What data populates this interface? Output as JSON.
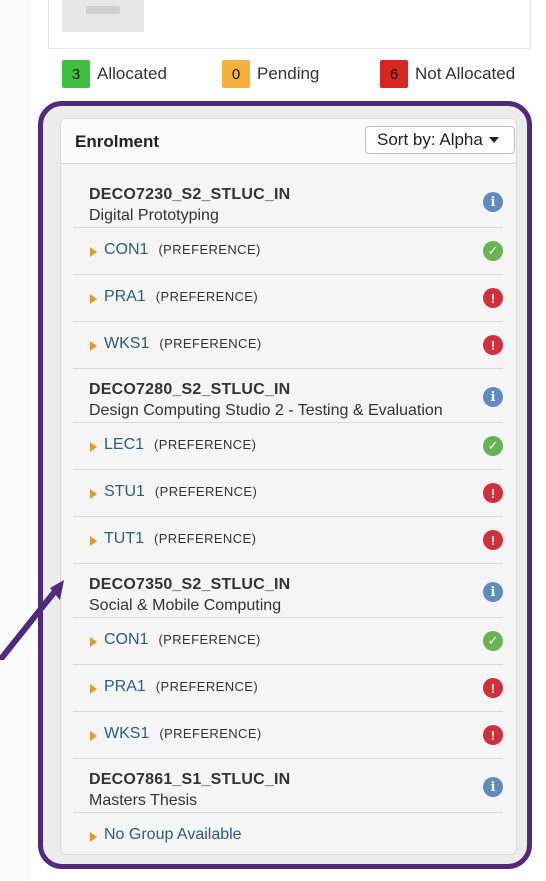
{
  "legend": [
    {
      "count": "3",
      "label": "Allocated",
      "color": "#3fbf3f"
    },
    {
      "count": "0",
      "label": "Pending",
      "color": "#f5b13a"
    },
    {
      "count": "6",
      "label": "Not Allocated",
      "color": "#d7261f"
    }
  ],
  "enrolment": {
    "title": "Enrolment",
    "sort_label": "Sort by: Alpha"
  },
  "courses": [
    {
      "code": "DECO7230_S2_STLUC_IN",
      "name": "Digital Prototyping",
      "groups": [
        {
          "code": "CON1",
          "pref": "(PREFERENCE)",
          "status": "allocated"
        },
        {
          "code": "PRA1",
          "pref": "(PREFERENCE)",
          "status": "not-allocated"
        },
        {
          "code": "WKS1",
          "pref": "(PREFERENCE)",
          "status": "not-allocated"
        }
      ]
    },
    {
      "code": "DECO7280_S2_STLUC_IN",
      "name": "Design Computing Studio 2 - Testing & Evaluation",
      "groups": [
        {
          "code": "LEC1",
          "pref": "(PREFERENCE)",
          "status": "allocated"
        },
        {
          "code": "STU1",
          "pref": "(PREFERENCE)",
          "status": "not-allocated"
        },
        {
          "code": "TUT1",
          "pref": "(PREFERENCE)",
          "status": "not-allocated"
        }
      ]
    },
    {
      "code": "DECO7350_S2_STLUC_IN",
      "name": "Social & Mobile Computing",
      "groups": [
        {
          "code": "CON1",
          "pref": "(PREFERENCE)",
          "status": "allocated"
        },
        {
          "code": "PRA1",
          "pref": "(PREFERENCE)",
          "status": "not-allocated"
        },
        {
          "code": "WKS1",
          "pref": "(PREFERENCE)",
          "status": "not-allocated"
        }
      ]
    },
    {
      "code": "DECO7861_S1_STLUC_IN",
      "name": "Masters Thesis",
      "no_group": "No Group Available"
    }
  ]
}
